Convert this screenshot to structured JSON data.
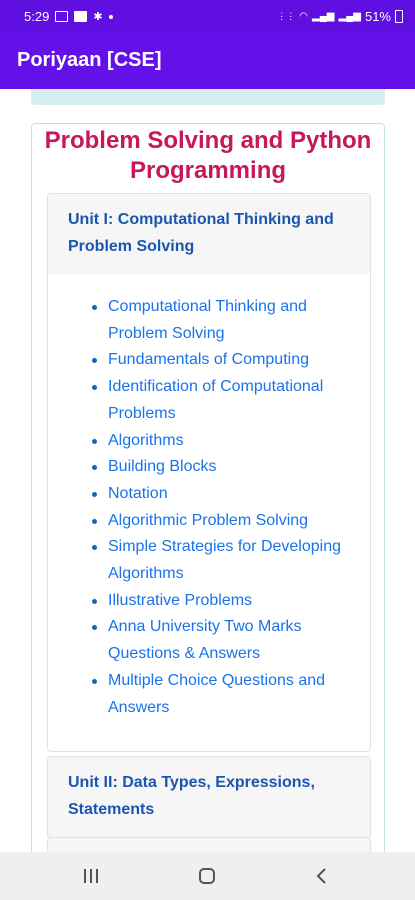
{
  "status_bar": {
    "time": "5:29",
    "battery": "51%",
    "left_icons": [
      "gallery-icon",
      "youtube-icon",
      "settings-icon",
      "dot-icon"
    ],
    "right_icons": [
      "vowifi-icon",
      "wifi-icon",
      "signal-icon",
      "signal-icon",
      "battery-icon"
    ]
  },
  "app_bar": {
    "title": "Poriyaan [CSE]"
  },
  "colors": {
    "app_bar": "#6311e8",
    "title_accent": "#c8175b",
    "unit_header_text": "#1a56b0",
    "link": "#1a73e8"
  },
  "subject": {
    "title": "Problem Solving and Python Programming",
    "units": [
      {
        "title": "Unit I: Computational Thinking and Problem Solving",
        "expanded": true,
        "topics": [
          "Computational Thinking and Problem Solving",
          "Fundamentals of Computing",
          "Identification of Computational Problems",
          "Algorithms",
          "Building Blocks",
          "Notation",
          "Algorithmic Problem Solving",
          "Simple Strategies for Developing Algorithms",
          "Illustrative Problems",
          "Anna University Two Marks Questions & Answers",
          "Multiple Choice Questions and Answers"
        ]
      },
      {
        "title": "Unit II: Data Types, Expressions, Statements",
        "expanded": false
      }
    ]
  },
  "nav_bar": {
    "buttons": [
      "recent-apps-icon",
      "home-icon",
      "back-icon"
    ]
  }
}
